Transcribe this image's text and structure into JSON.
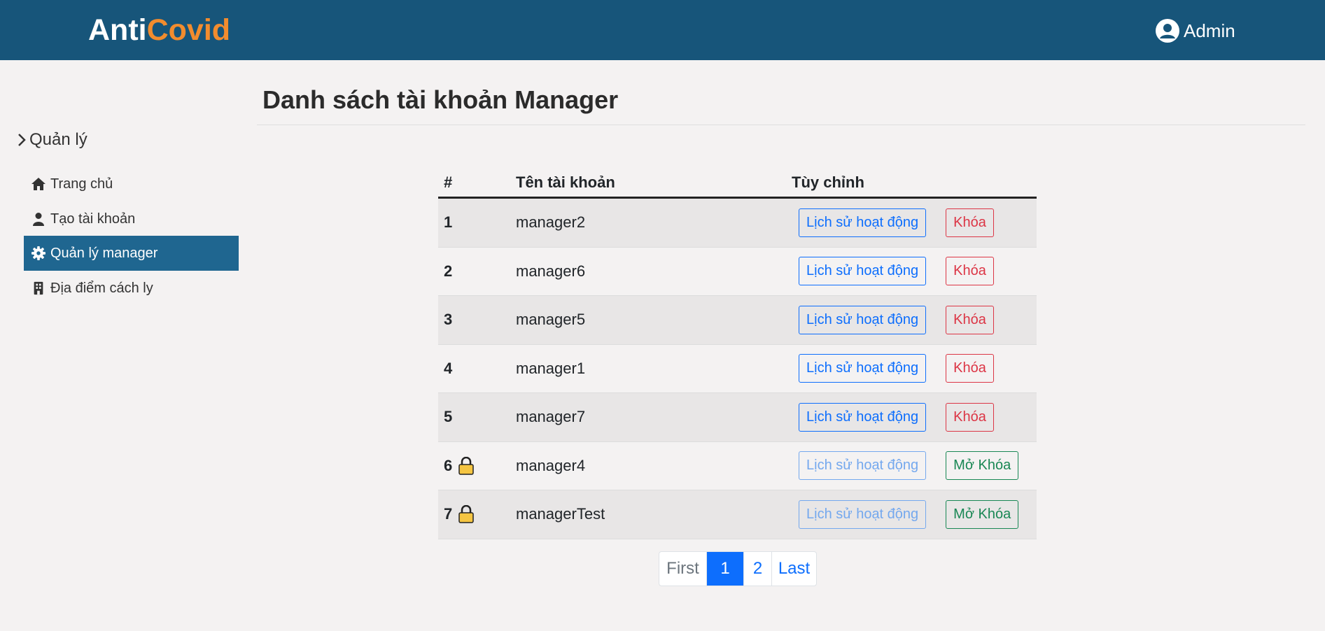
{
  "brand": {
    "part1": "Anti",
    "part2": "Covid"
  },
  "user": {
    "name": "Admin"
  },
  "sidebar": {
    "heading": "Quản lý",
    "items": [
      {
        "label": "Trang chủ",
        "icon": "home-icon"
      },
      {
        "label": "Tạo tài khoản",
        "icon": "user-icon"
      },
      {
        "label": "Quản lý manager",
        "icon": "gear-icon",
        "active": true
      },
      {
        "label": "Địa điểm cách ly",
        "icon": "building-icon"
      }
    ]
  },
  "page": {
    "title": "Danh sách tài khoản Manager"
  },
  "table": {
    "headers": [
      "#",
      "Tên tài khoản",
      "Tùy chỉnh"
    ],
    "history_label": "Lịch sử hoạt động",
    "rows": [
      {
        "idx": "1",
        "name": "manager2",
        "action": "Khóa",
        "locked": false
      },
      {
        "idx": "2",
        "name": "manager6",
        "action": "Khóa",
        "locked": false
      },
      {
        "idx": "3",
        "name": "manager5",
        "action": "Khóa",
        "locked": false
      },
      {
        "idx": "4",
        "name": "manager1",
        "action": "Khóa",
        "locked": false
      },
      {
        "idx": "5",
        "name": "manager7",
        "action": "Khóa",
        "locked": false
      },
      {
        "idx": "6",
        "name": "manager4",
        "action": "Mở Khóa",
        "locked": true
      },
      {
        "idx": "7",
        "name": "managerTest",
        "action": "Mở Khóa",
        "locked": true
      }
    ]
  },
  "pagination": {
    "first": "First",
    "pages": [
      "1",
      "2"
    ],
    "current": "1",
    "last": "Last"
  },
  "colors": {
    "navbar": "#17557a",
    "brand_accent": "#f28c2e",
    "sidebar_active": "#1f6690",
    "primary": "#0d6efd",
    "danger": "#dc3545",
    "success": "#198754"
  }
}
